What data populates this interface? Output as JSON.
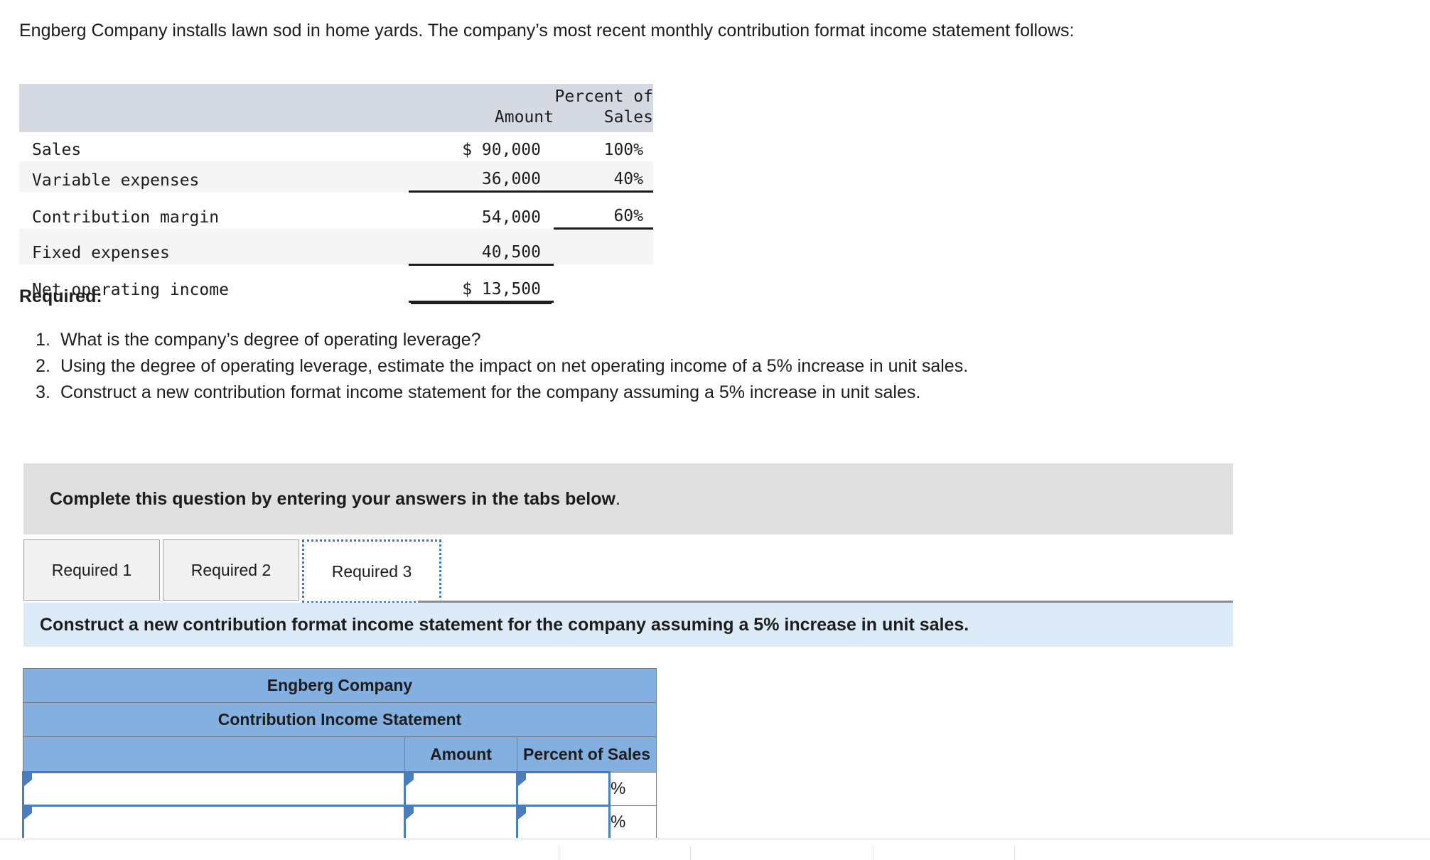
{
  "intro": "Engberg Company installs lawn sod in home yards. The company’s most recent monthly contribution format income statement follows:",
  "given_statement": {
    "headers": {
      "label": "",
      "amount": "Amount",
      "percent_line1": "Percent of",
      "percent_line2": "Sales"
    },
    "rows": [
      {
        "label": "Sales",
        "amount": "$ 90,000",
        "percent": "100%"
      },
      {
        "label": "Variable expenses",
        "amount": "36,000",
        "percent": "40%"
      },
      {
        "label": "Contribution margin",
        "amount": "54,000",
        "percent": "60%"
      },
      {
        "label": "Fixed expenses",
        "amount": "40,500",
        "percent": ""
      },
      {
        "label": "Net operating income",
        "amount": "$ 13,500",
        "percent": ""
      }
    ]
  },
  "required": {
    "heading": "Required:",
    "items": [
      {
        "num": "1.",
        "text": "What is the company’s degree of operating leverage?"
      },
      {
        "num": "2.",
        "text": "Using the degree of operating leverage, estimate the impact on net operating income of a 5% increase in unit sales."
      },
      {
        "num": "3.",
        "text": "Construct a new contribution format income statement for the company assuming a 5% increase in unit sales."
      }
    ]
  },
  "instruction_banner": {
    "bold_part": "Complete this question by entering your answers in the tabs below",
    "trailing": "."
  },
  "tabs": [
    {
      "label": "Required 1",
      "selected": false
    },
    {
      "label": "Required 2",
      "selected": false
    },
    {
      "label": "Required 3",
      "selected": true
    }
  ],
  "sub_instruction": "Construct a new contribution format income statement for the company assuming a 5% increase in unit sales.",
  "answer_table": {
    "title_line1": "Engberg Company",
    "title_line2": "Contribution Income Statement",
    "col_blank": "",
    "col_amount": "Amount",
    "col_percent": "Percent of Sales",
    "percent_sign": "%",
    "rows": [
      {
        "label": "",
        "amount": "",
        "percent": ""
      },
      {
        "label": "",
        "amount": "",
        "percent": ""
      }
    ]
  },
  "colors": {
    "given_header_bg": "#d5dae2",
    "given_alt_row_bg": "#f5f5f6",
    "instruction_bg": "#e0e0e0",
    "sub_instruction_bg": "#dcebf7",
    "answer_header_bg": "#83b0e0",
    "input_border": "#4a7ebb",
    "tab_focus": "#4274b8"
  }
}
